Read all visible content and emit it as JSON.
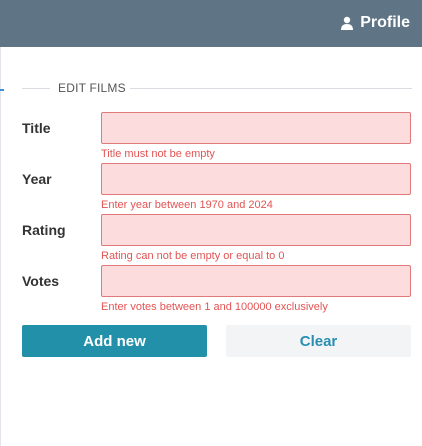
{
  "header": {
    "profile_label": "Profile",
    "profile_icon": "user-icon"
  },
  "form": {
    "legend": "EDIT FILMS",
    "fields": [
      {
        "label": "Title",
        "value": "",
        "error": "Title must not be empty"
      },
      {
        "label": "Year",
        "value": "",
        "error": "Enter year between 1970 and 2024"
      },
      {
        "label": "Rating",
        "value": "",
        "error": "Rating can not be empty or equal to 0"
      },
      {
        "label": "Votes",
        "value": "",
        "error": "Enter votes between 1 and 100000 exclusively"
      }
    ],
    "add_label": "Add new",
    "clear_label": "Clear"
  },
  "colors": {
    "topbar": "#5f7585",
    "primary": "#2290a8",
    "error_text": "#e25454",
    "error_bg": "#fcdcdc"
  }
}
